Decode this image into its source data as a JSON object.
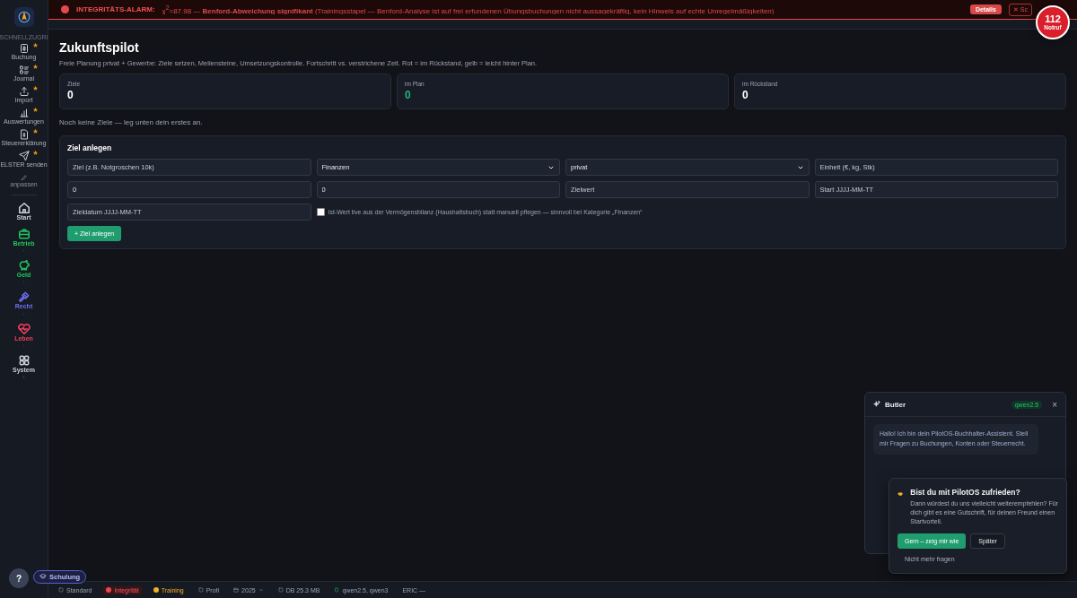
{
  "alarm": {
    "title": "INTEGRITÄTS-ALARM:",
    "message": "χ$^{2}$=87.98 — **Benford-Abweichung signifikant** (Trainingsstapel — Benford-Analyse ist auf frei erfundenen Übungsbuchungen nicht aussagekräftig, kein Hinweis auf echte Unregelmäßigkeiten)",
    "details": "Details",
    "close": "✕ Sc"
  },
  "emergency": {
    "number": "112",
    "label": "Notruf"
  },
  "sidebar": {
    "section_label": "SCHNELLZUGRI",
    "quick_items": [
      {
        "label": "Buchung",
        "starred": true
      },
      {
        "label": "Journal",
        "starred": true
      },
      {
        "label": "Import",
        "starred": true
      },
      {
        "label": "Auswertungen",
        "starred": true
      },
      {
        "label": "Steuererklärung",
        "starred": true
      },
      {
        "label": "ELSTER senden",
        "starred": true
      }
    ],
    "customize": "anpassen",
    "areas": [
      {
        "label": "Start",
        "color": "#c9ced8",
        "expandable": false
      },
      {
        "label": "Betrieb",
        "color": "#22c55e",
        "expandable": true
      },
      {
        "label": "Geld",
        "color": "#22c55e",
        "expandable": true
      },
      {
        "label": "Recht",
        "color": "#6d6ff5",
        "expandable": true
      },
      {
        "label": "Leben",
        "color": "#f43f5e",
        "expandable": true
      },
      {
        "label": "System",
        "color": "#c9ced8",
        "expandable": true
      }
    ]
  },
  "page": {
    "title": "Zukunftspilot",
    "description": "Freie Planung privat + Gewerbe: Ziele setzen, Meilensteine, Umsetzungskontrolle. Fortschritt vs. verstrichene Zeit. Rot = im Rückstand, gelb = leicht hinter Plan.",
    "stats": [
      {
        "label": "Ziele",
        "value": "0",
        "kind": "neutral"
      },
      {
        "label": "im Plan",
        "value": "0",
        "kind": "good"
      },
      {
        "label": "im Rückstand",
        "value": "0",
        "kind": "neutral"
      }
    ],
    "empty_message": "Noch keine Ziele — leg unten dein erstes an.",
    "form": {
      "title": "Ziel anlegen",
      "fields": [
        {
          "kind": "input",
          "placeholder": "Ziel (z.B. Notgroschen 10k)"
        },
        {
          "kind": "select",
          "value": "Finanzen"
        },
        {
          "kind": "select",
          "value": "privat"
        },
        {
          "kind": "input",
          "placeholder": "Einheit (€, kg, Stk)"
        },
        {
          "kind": "input",
          "value": "0"
        },
        {
          "kind": "input",
          "value": "0"
        },
        {
          "kind": "input",
          "placeholder": "Zielwert"
        },
        {
          "kind": "input",
          "placeholder": "Start JJJJ-MM-TT"
        },
        {
          "kind": "input",
          "placeholder": "Zieldatum JJJJ-MM-TT"
        }
      ],
      "live_checkbox": {
        "label": "Ist-Wert live aus der Vermögensbilanz (Haushaltsbuch) statt manuell pflegen — sinnvoll bei Kategorie „Finanzen“",
        "checked": false
      },
      "submit": "+ Ziel anlegen"
    }
  },
  "butler": {
    "title": "Butler",
    "model": "qwen2.5",
    "close": "×",
    "message": "Hallo! Ich bin dein PilotOS-Buchhalter-Assistent. Stell mir Fragen zu Buchungen, Konten oder Steuerrecht."
  },
  "feedback": {
    "title": "Bist du mit PilotOS zufrieden?",
    "text": "Dann würdest du uns vielleicht weiterempfehlen? Für dich gibt es eine Gutschrift, für deinen Freund einen Startvorteil.",
    "accept": "Gern – zeig mir wie",
    "later": "Später",
    "never": "Nicht mehr fragen"
  },
  "help": "?",
  "training_button": "Schulung",
  "status_bar": [
    {
      "label": "Standard",
      "kind": "plain"
    },
    {
      "label": "Integrität",
      "kind": "alert"
    },
    {
      "label": "Training",
      "kind": "warn"
    },
    {
      "label": "Profi",
      "kind": "plain"
    },
    {
      "label": "2025",
      "kind": "menu"
    },
    {
      "label": "DB 25.3 MB",
      "kind": "plain"
    },
    {
      "label": "qwen2.5, qwen3",
      "kind": "ok"
    },
    {
      "label": "ERIC —",
      "kind": "text"
    }
  ]
}
